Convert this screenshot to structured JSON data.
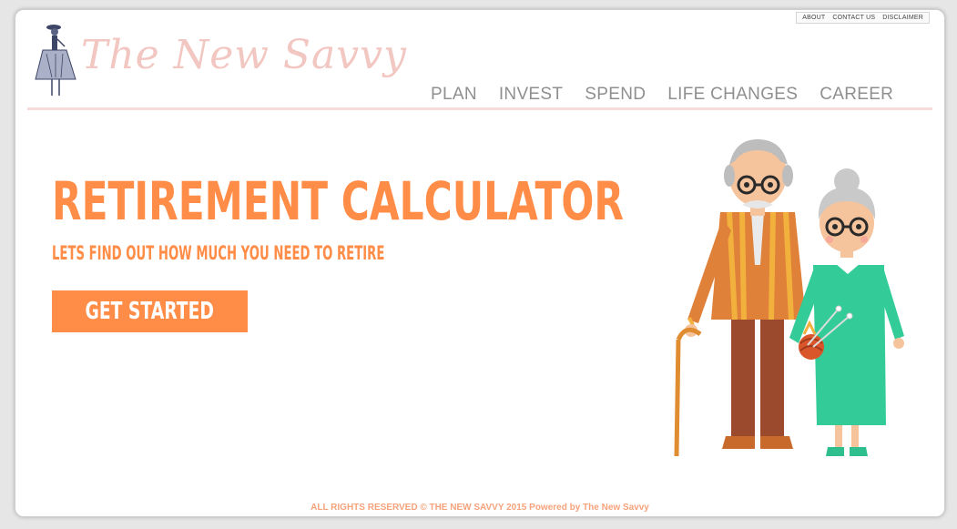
{
  "top_links": [
    "ABOUT",
    "CONTACT US",
    "DISCLAIMER"
  ],
  "logo": {
    "text": "The New Savvy"
  },
  "nav": [
    "PLAN",
    "INVEST",
    "SPEND",
    "LIFE CHANGES",
    "CAREER"
  ],
  "hero": {
    "title": "RETIREMENT CALCULATOR",
    "subtitle": "LETS FIND OUT HOW MUCH YOU NEED TO RETIRE",
    "cta": "GET STARTED"
  },
  "footer": {
    "text": "ALL RIGHTS RESERVED © THE NEW SAVVY 2015 Powered by The New Savvy"
  },
  "colors": {
    "accent": "#ff8c47",
    "nav_text": "#8f8f8f",
    "logo": "#f2c6c1",
    "rule": "#f7dada",
    "footer": "#f6a27b"
  },
  "icons": {
    "logo_figure": "woman-in-dress-figure",
    "illustration": "elderly-couple-illustration"
  }
}
